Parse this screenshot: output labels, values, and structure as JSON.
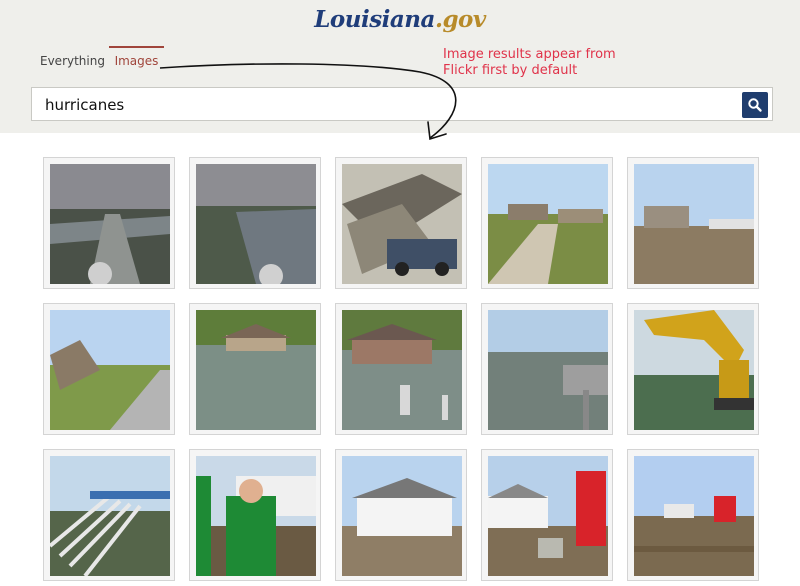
{
  "logo": {
    "part1": "Louisiana",
    "part2": ".gov"
  },
  "tabs": [
    {
      "label": "Everything",
      "active": false
    },
    {
      "label": "Images",
      "active": true
    }
  ],
  "annotation": {
    "line1": "Image results appear from",
    "line2": "Flickr first by default"
  },
  "search": {
    "query": "hurricanes"
  },
  "colors": {
    "accent": "#a0453b",
    "annotation": "#e0334a",
    "button": "#1f3d6e",
    "header_bg": "#efefeb"
  },
  "images": [
    {
      "scene": "flooded-road-aerial-storm"
    },
    {
      "scene": "flooded-river-aerial-storm"
    },
    {
      "scene": "collapsed-house-truck"
    },
    {
      "scene": "damaged-houses-gravel-road"
    },
    {
      "scene": "damaged-houses-dirt-lot"
    },
    {
      "scene": "collapsed-house-roadside"
    },
    {
      "scene": "flooded-house-trees"
    },
    {
      "scene": "submerged-house-poles"
    },
    {
      "scene": "flooded-yard-mailbox"
    },
    {
      "scene": "excavator-flood-water"
    },
    {
      "scene": "pipes-in-water"
    },
    {
      "scene": "inspectors-with-clipboard"
    },
    {
      "scene": "damaged-house-debris"
    },
    {
      "scene": "house-red-truck-debris"
    },
    {
      "scene": "debris-field-red-truck"
    }
  ]
}
